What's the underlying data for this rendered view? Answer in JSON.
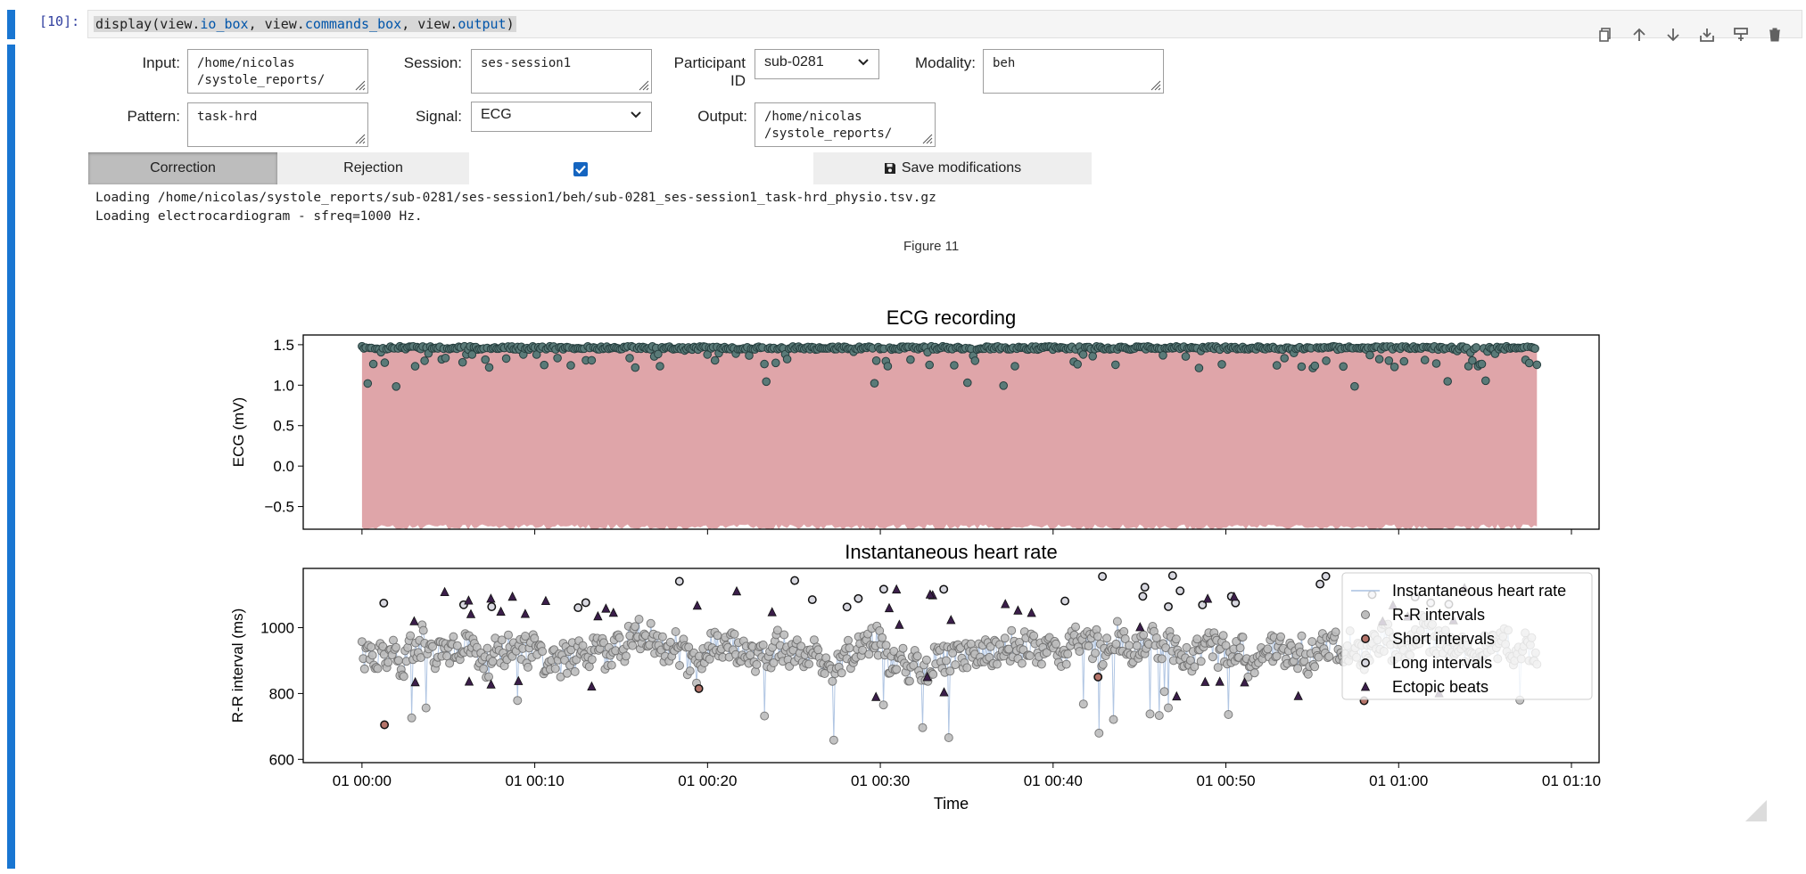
{
  "cell": {
    "prompt": "[10]:",
    "code_prefix": "display(view.",
    "code_io": "io_box",
    "code_mid1": ", view.",
    "code_cmd": "commands_box",
    "code_mid2": ", view.",
    "code_out": "output",
    "code_suffix": ")",
    "toolbar": [
      "copy-icon",
      "move-up-icon",
      "move-down-icon",
      "insert-below-icon",
      "insert-above-icon",
      "delete-icon"
    ]
  },
  "form": {
    "input_label": "Input:",
    "input_value": "/home/nicolas\n/systole_reports/",
    "session_label": "Session:",
    "session_value": "ses-session1",
    "participant_label": "Participant ID",
    "participant_value": "sub-0281",
    "modality_label": "Modality:",
    "modality_value": "beh",
    "pattern_label": "Pattern:",
    "pattern_value": "task-hrd",
    "signal_label": "Signal:",
    "signal_value": "ECG",
    "output_label": "Output:",
    "output_value": "/home/nicolas\n/systole_reports/"
  },
  "commands": {
    "correction_label": "Correction",
    "rejection_label": "Rejection",
    "checkbox_checked": true,
    "save_label": "Save modifications"
  },
  "log": {
    "line1": "Loading /home/nicolas/systole_reports/sub-0281/ses-session1/beh/sub-0281_ses-session1_task-hrd_physio.tsv.gz",
    "line2": "Loading electrocardiogram - sfreq=1000 Hz."
  },
  "figure_label": "Figure 11",
  "colors": {
    "accent": "#1976d2",
    "ecg_fill": "#d9959a",
    "peaks": "#2f4f4f",
    "rr_points": "#bdbdbd",
    "hr_line": "#a9c0e0",
    "ectopic": "#3b1e4a",
    "checkbox": "#1565c0"
  },
  "chart_data": [
    {
      "type": "area",
      "title": "ECG recording",
      "ylabel": "ECG (mV)",
      "xlabel": "",
      "yticks": [
        "1.5",
        "1.0",
        "0.5",
        "0.0",
        "−0.5"
      ],
      "ytick_values": [
        1.5,
        1.0,
        0.5,
        0.0,
        -0.5
      ],
      "ylim": [
        -0.78,
        1.62
      ],
      "signal_range_mV": [
        -0.72,
        1.45
      ],
      "r_peaks_mV": {
        "typical": 1.48,
        "min": 0.98
      },
      "x_start_min": 0,
      "x_end_min": 68
    },
    {
      "type": "scatter",
      "title": "Instantaneous heart rate",
      "ylabel": "R-R interval (ms)",
      "xlabel": "Time",
      "yticks": [
        "1000",
        "800",
        "600"
      ],
      "ytick_values": [
        1000,
        800,
        600
      ],
      "ylim": [
        590,
        1180
      ],
      "xticks": [
        "01 00:00",
        "01 00:10",
        "01 00:20",
        "01 00:30",
        "01 00:40",
        "01 00:50",
        "01 01:00",
        "01 01:10"
      ],
      "xtick_minutes": [
        0,
        10,
        20,
        30,
        40,
        50,
        60,
        70
      ],
      "xlim_min": [
        -3.4,
        71.6
      ],
      "rr_range_ms": [
        620,
        1160
      ],
      "rr_mean_ms": 930,
      "legend": {
        "placement": "upper right",
        "entries": [
          "Instantaneous heart rate",
          "R-R intervals",
          "Short intervals",
          "Long intervals",
          "Ectopic beats"
        ]
      }
    }
  ]
}
